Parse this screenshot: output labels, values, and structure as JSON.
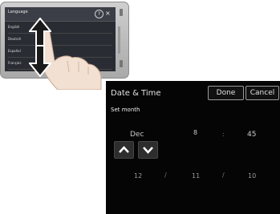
{
  "device": {
    "screen_title": "Language",
    "help_icon": "?",
    "close_icon": "×",
    "rows": [
      "English",
      "Deutsch",
      "Español",
      "Français"
    ]
  },
  "panel": {
    "title": "Date & Time",
    "done_label": "Done",
    "cancel_label": "Cancel",
    "subtitle": "Set month",
    "picker": {
      "month": "Dec",
      "hour": "8",
      "colon": ":",
      "minute": "45"
    },
    "date": {
      "day": "12",
      "sep1": "/",
      "month_num": "11",
      "sep2": "/",
      "year": "10"
    }
  }
}
